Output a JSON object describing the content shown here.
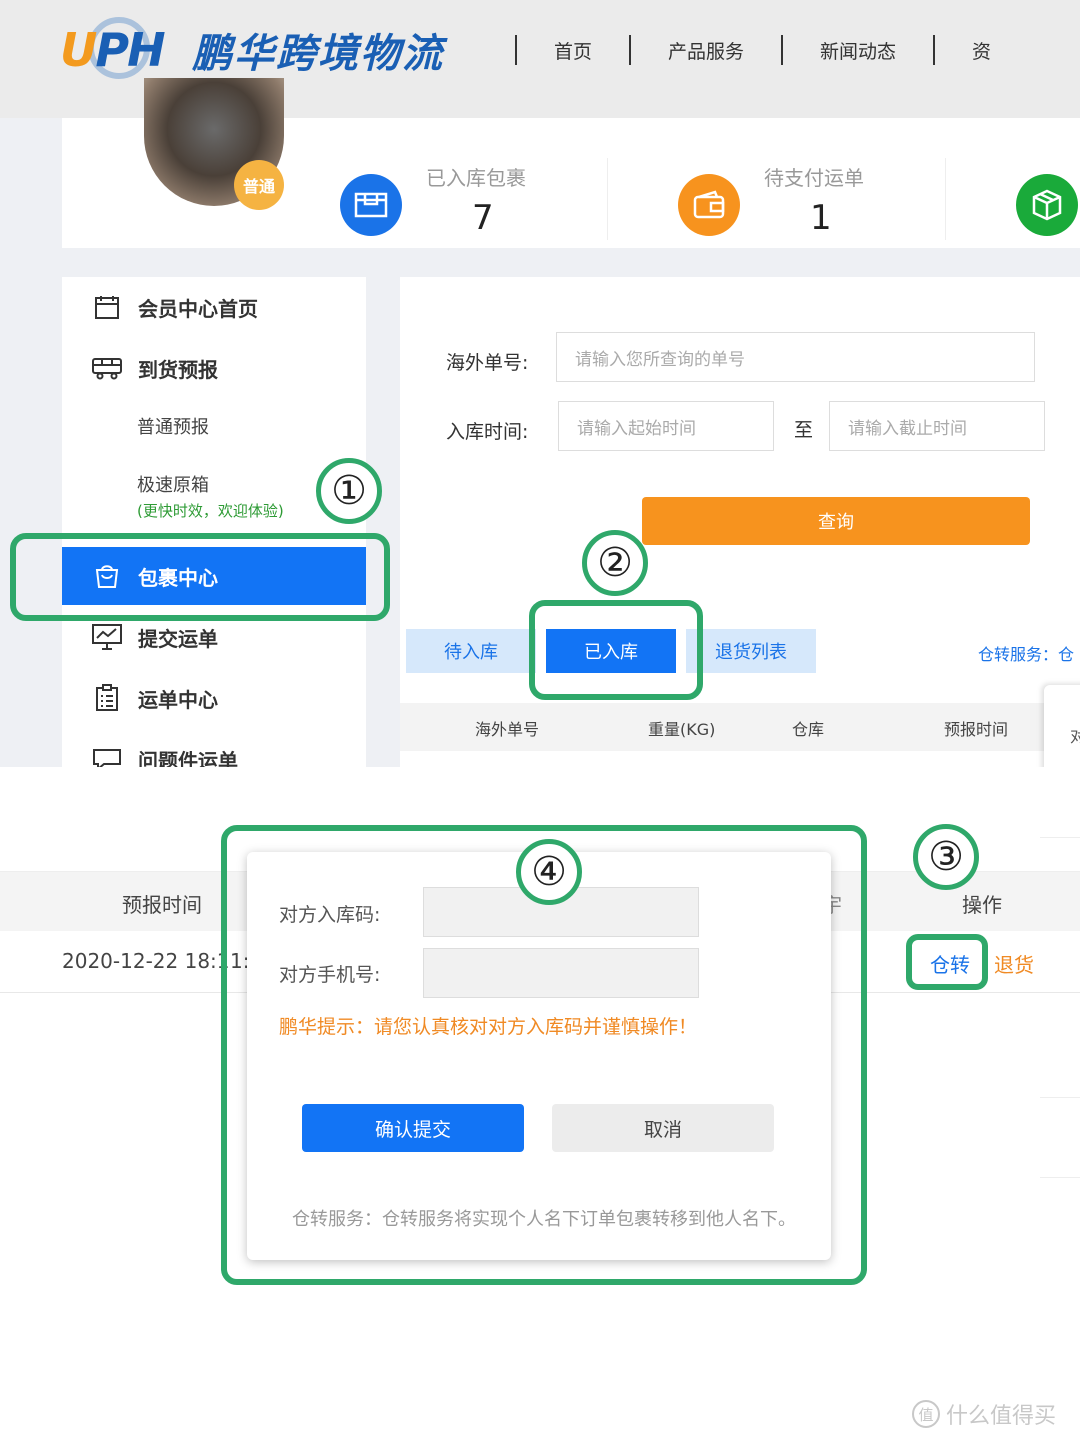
{
  "header": {
    "logo_letters_u": "U",
    "logo_letters_ph": "PH",
    "brand": "鹏华跨境物流",
    "nav": [
      "首页",
      "产品服务",
      "新闻动态",
      "资"
    ]
  },
  "stats": {
    "member_badge": "普通",
    "items": [
      {
        "label": "已入库包裹",
        "value": "7",
        "icon": "warehouse-box-icon",
        "color": "#1a73e8"
      },
      {
        "label": "待支付运单",
        "value": "1",
        "icon": "wallet-icon",
        "color": "#f7931e"
      },
      {
        "label": "",
        "value": "",
        "icon": "package-cube-icon",
        "color": "#1aaa3a"
      }
    ]
  },
  "sidebar": {
    "items": [
      {
        "label": "会员中心首页",
        "icon": "calendar-icon"
      },
      {
        "label": "到货预报",
        "icon": "truck-icon"
      },
      {
        "label": "包裹中心",
        "icon": "shopping-bag-icon"
      },
      {
        "label": "提交运单",
        "icon": "monitor-chart-icon"
      },
      {
        "label": "运单中心",
        "icon": "clipboard-list-icon"
      },
      {
        "label": "问题件运单",
        "icon": "chat-icon"
      }
    ],
    "sub_normal": "普通预报",
    "sub_express": "极速原箱",
    "sub_express_promo": "(更快时效，欢迎体验)"
  },
  "search": {
    "overseas_label": "海外单号:",
    "overseas_placeholder": "请输入您所查询的单号",
    "time_label": "入库时间:",
    "start_placeholder": "请输入起始时间",
    "to": "至",
    "end_placeholder": "请输入截止时间",
    "query_button": "查询"
  },
  "tabs": [
    "待入库",
    "已入库",
    "退货列表"
  ],
  "transfer_service_link": "仓转服务：仓",
  "table_header": [
    "海外单号",
    "重量(KG)",
    "仓库",
    "预报时间",
    "对"
  ],
  "zoom_table": {
    "head_forecast": "预报时间",
    "head_partial": "宇",
    "head_action": "操作",
    "row_time": "2020-12-22 18:1",
    "row_time_tail": "1:",
    "transfer_link": "仓转",
    "return_link": "退货"
  },
  "dialog": {
    "code_label": "对方入库码:",
    "phone_label": "对方手机号:",
    "tip": "鹏华提示：请您认真核对对方入库码并谨慎操作！",
    "confirm_button": "确认提交",
    "cancel_button": "取消",
    "note": "仓转服务：仓转服务将实现个人名下订单包裹转移到他人名下。"
  },
  "annotations": [
    "①",
    "②",
    "③",
    "④"
  ],
  "highlight_color": "#2fa86a",
  "watermark": "什么值得买",
  "watermark_icon": "值"
}
